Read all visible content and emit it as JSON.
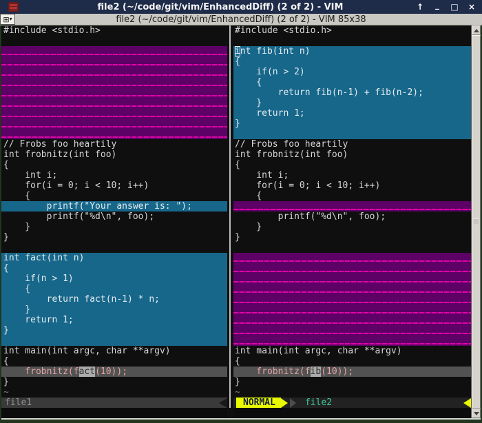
{
  "window": {
    "title": "file2 (~/code/git/vim/EnhancedDiff) (2 of 2) - VIM",
    "controls": {
      "shade": "↑",
      "minimize": "_",
      "maximize": "□",
      "close": "×"
    }
  },
  "inner_titlebar": {
    "title": "file2 (~/code/git/vim/EnhancedDiff) (2 of 2) - VIM 85x38"
  },
  "icons": {
    "window_menu_grid": "⊞",
    "window_menu_caret": "▾"
  },
  "statusline": {
    "left_file": "file1",
    "mode": "NORMAL",
    "right_file": "file2"
  },
  "colors": {
    "titlebar_bg": "#1e2b49",
    "diff_add_bg": "#17678b",
    "diff_filler_bg": "#5d0166",
    "diff_filler_line": "#e203a8",
    "diff_change_bg": "#525252",
    "diff_text_bg": "#ababab",
    "mode_normal_bg": "#e9fa00",
    "right_file_color": "#3fc795"
  },
  "panes": {
    "left": {
      "rows": [
        {
          "hl": "norm",
          "text": "#include <stdio.h>"
        },
        {
          "hl": "blank"
        },
        {
          "hl": "fill"
        },
        {
          "hl": "fill"
        },
        {
          "hl": "fill"
        },
        {
          "hl": "fill"
        },
        {
          "hl": "fill"
        },
        {
          "hl": "fill"
        },
        {
          "hl": "fill"
        },
        {
          "hl": "fill"
        },
        {
          "hl": "fill"
        },
        {
          "hl": "norm",
          "text": "// Frobs foo heartily"
        },
        {
          "hl": "norm",
          "text": "int frobnitz(int foo)"
        },
        {
          "hl": "norm",
          "text": "{"
        },
        {
          "hl": "norm",
          "text": "    int i;"
        },
        {
          "hl": "norm",
          "text": "    for(i = 0; i < 10; i++)"
        },
        {
          "hl": "norm",
          "text": "    {"
        },
        {
          "hl": "add",
          "text": "        printf(\"Your answer is: \");"
        },
        {
          "hl": "norm",
          "text": "        printf(\"%d\\n\", foo);"
        },
        {
          "hl": "norm",
          "text": "    }"
        },
        {
          "hl": "norm",
          "text": "}"
        },
        {
          "hl": "blank"
        },
        {
          "hl": "add",
          "text": "int fact(int n)"
        },
        {
          "hl": "add",
          "text": "{"
        },
        {
          "hl": "add",
          "text": "    if(n > 1)"
        },
        {
          "hl": "add",
          "text": "    {"
        },
        {
          "hl": "add",
          "text": "        return fact(n-1) * n;"
        },
        {
          "hl": "add",
          "text": "    }"
        },
        {
          "hl": "add",
          "text": "    return 1;"
        },
        {
          "hl": "add",
          "text": "}"
        },
        {
          "hl": "add",
          "text": ""
        },
        {
          "hl": "norm",
          "text": "int main(int argc, char **argv)"
        },
        {
          "hl": "norm",
          "text": "{"
        },
        {
          "hl": "change",
          "pre": "    frobnitz(f",
          "mark": "act",
          "post": "(10));"
        },
        {
          "hl": "norm",
          "text": "}"
        },
        {
          "hl": "tilde",
          "text": "~"
        }
      ]
    },
    "right": {
      "rows": [
        {
          "hl": "norm",
          "text": "#include <stdio.h>"
        },
        {
          "hl": "blank"
        },
        {
          "hl": "add",
          "text": "int fib(int n)",
          "cursor": true
        },
        {
          "hl": "add",
          "text": "{"
        },
        {
          "hl": "add",
          "text": "    if(n > 2)"
        },
        {
          "hl": "add",
          "text": "    {"
        },
        {
          "hl": "add",
          "text": "        return fib(n-1) + fib(n-2);"
        },
        {
          "hl": "add",
          "text": "    }"
        },
        {
          "hl": "add",
          "text": "    return 1;"
        },
        {
          "hl": "add",
          "text": "}"
        },
        {
          "hl": "add",
          "text": ""
        },
        {
          "hl": "norm",
          "text": "// Frobs foo heartily"
        },
        {
          "hl": "norm",
          "text": "int frobnitz(int foo)"
        },
        {
          "hl": "norm",
          "text": "{"
        },
        {
          "hl": "norm",
          "text": "    int i;"
        },
        {
          "hl": "norm",
          "text": "    for(i = 0; i < 10; i++)"
        },
        {
          "hl": "norm",
          "text": "    {"
        },
        {
          "hl": "fill"
        },
        {
          "hl": "norm",
          "text": "        printf(\"%d\\n\", foo);"
        },
        {
          "hl": "norm",
          "text": "    }"
        },
        {
          "hl": "norm",
          "text": "}"
        },
        {
          "hl": "blank"
        },
        {
          "hl": "fill"
        },
        {
          "hl": "fill"
        },
        {
          "hl": "fill"
        },
        {
          "hl": "fill"
        },
        {
          "hl": "fill"
        },
        {
          "hl": "fill"
        },
        {
          "hl": "fill"
        },
        {
          "hl": "fill"
        },
        {
          "hl": "fill"
        },
        {
          "hl": "norm",
          "text": "int main(int argc, char **argv)"
        },
        {
          "hl": "norm",
          "text": "{"
        },
        {
          "hl": "change",
          "pre": "    frobnitz(f",
          "mark": "ib",
          "post": "(10));"
        },
        {
          "hl": "norm",
          "text": "}"
        },
        {
          "hl": "tilde",
          "text": "~"
        }
      ]
    }
  }
}
